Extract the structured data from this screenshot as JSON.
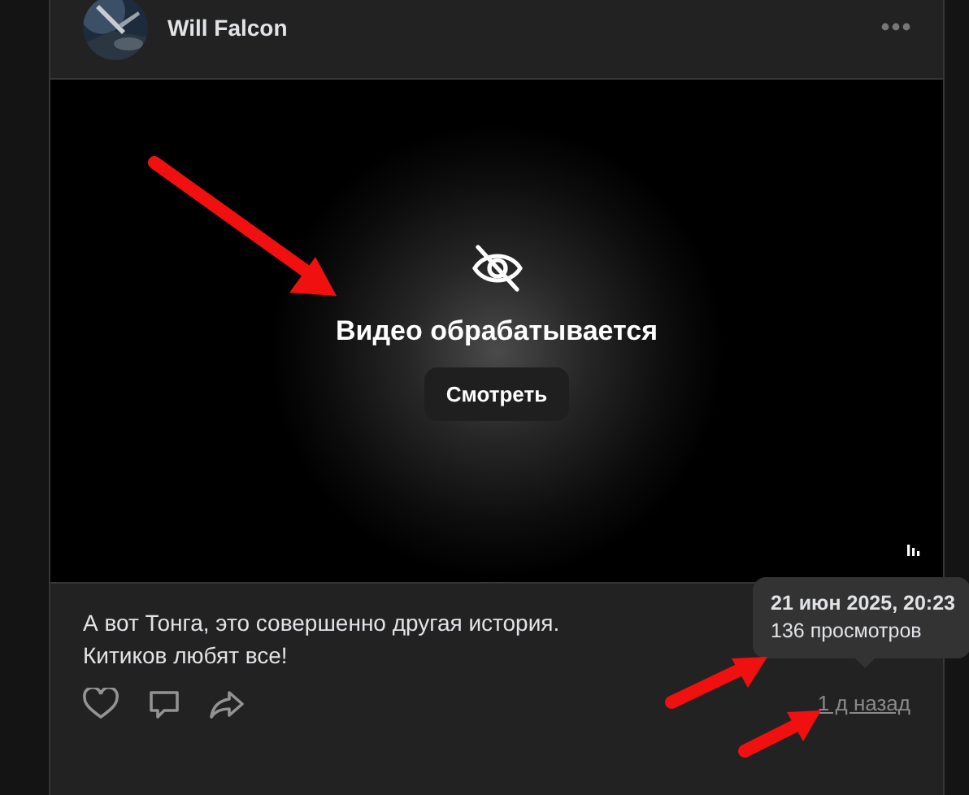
{
  "post": {
    "author": "Will Falcon",
    "video": {
      "status": "Видео обрабатывается",
      "button": "Смотреть"
    },
    "text_lines": [
      "А вот Тонга, это совершенно другая история.",
      "Китиков любят все!"
    ],
    "time": "1 д назад",
    "tooltip": {
      "date": "21 июн 2025, 20:23",
      "views": "136 просмотров"
    }
  }
}
